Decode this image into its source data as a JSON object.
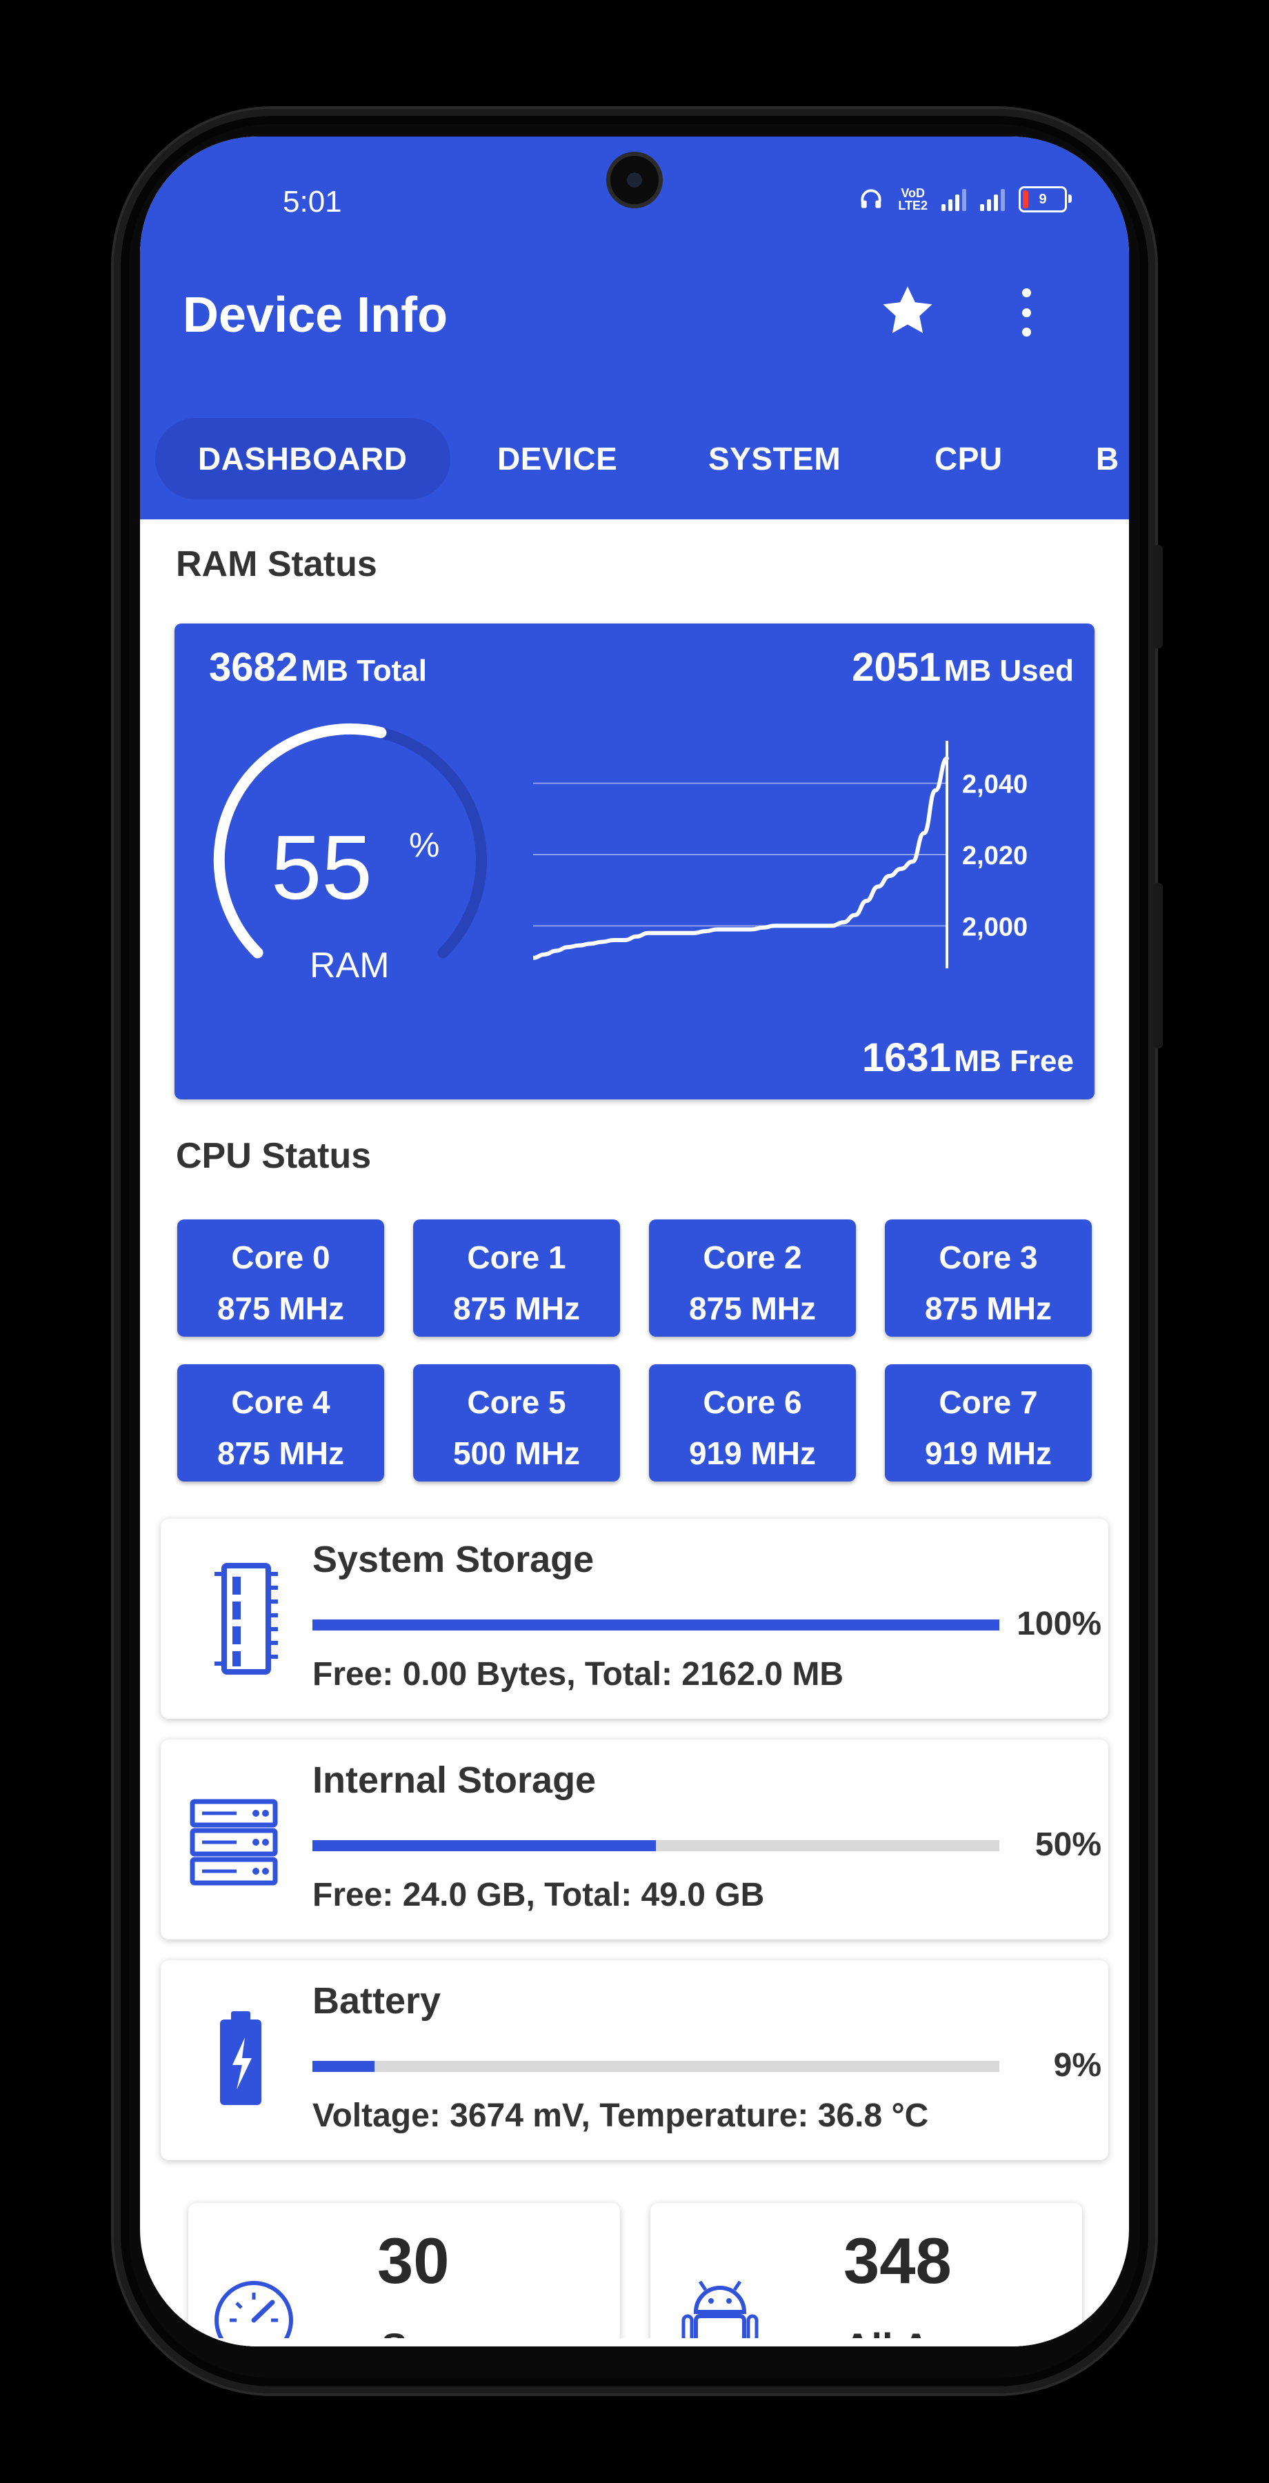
{
  "status_bar": {
    "time": "5:01",
    "volte_top": "VoD",
    "volte_bottom": "LTE2",
    "battery_level": "9",
    "battery_color": "#ff3b30"
  },
  "app_bar": {
    "title": "Device Info",
    "star_icon": "star-icon",
    "more_icon": "more-vert-icon"
  },
  "tabs": [
    "DASHBOARD",
    "DEVICE",
    "SYSTEM",
    "CPU",
    "B"
  ],
  "ram": {
    "section_title": "RAM Status",
    "total_value": "3682",
    "total_unit": "MB Total",
    "used_value": "2051",
    "used_unit": "MB Used",
    "free_value": "1631",
    "free_unit": "MB Free",
    "percent": "55",
    "percent_sign": "%",
    "gauge_label": "RAM",
    "gauge_fraction": 0.55
  },
  "chart_data": {
    "type": "line",
    "title": "",
    "xlabel": "",
    "ylabel": "",
    "yticks": [
      "2,040",
      "2,020",
      "2,000"
    ],
    "ytick_values": [
      2040,
      2020,
      2000
    ],
    "ylim": [
      1990,
      2050
    ],
    "grid": true,
    "series": [
      {
        "values": [
          1991,
          1992,
          1993,
          1994,
          1994.5,
          1995,
          1995.5,
          1996,
          1996,
          1997,
          1998,
          1998,
          1998,
          1998,
          1998,
          1998.5,
          1999,
          1999,
          1999,
          1999,
          1999.5,
          2000,
          2000,
          2000,
          2000,
          2000,
          2000,
          2001,
          2003,
          2007,
          2011,
          2014,
          2016,
          2018,
          2026,
          2038,
          2047
        ]
      }
    ]
  },
  "cpu": {
    "section_title": "CPU Status",
    "cores": [
      {
        "name": "Core 0",
        "freq": "875 MHz"
      },
      {
        "name": "Core 1",
        "freq": "875 MHz"
      },
      {
        "name": "Core 2",
        "freq": "875 MHz"
      },
      {
        "name": "Core 3",
        "freq": "875 MHz"
      },
      {
        "name": "Core 4",
        "freq": "875 MHz"
      },
      {
        "name": "Core 5",
        "freq": "500 MHz"
      },
      {
        "name": "Core 6",
        "freq": "919 MHz"
      },
      {
        "name": "Core 7",
        "freq": "919 MHz"
      }
    ]
  },
  "storage": [
    {
      "title": "System Storage",
      "percent": "100%",
      "fraction": 1.0,
      "detail": "Free: 0.00 Bytes, Total: 2162.0 MB",
      "icon": "memory-icon"
    },
    {
      "title": "Internal Storage",
      "percent": "50%",
      "fraction": 0.5,
      "detail": "Free: 24.0 GB, Total: 49.0 GB",
      "icon": "server-storage-icon"
    },
    {
      "title": "Battery",
      "percent": "9%",
      "fraction": 0.09,
      "detail": "Voltage: 3674 mV, Temperature: 36.8 °C",
      "icon": "battery-charging-icon"
    }
  ],
  "stats": [
    {
      "value": "30",
      "label": "Sensors",
      "icon": "speedometer-icon"
    },
    {
      "value": "348",
      "label": "All Apps",
      "icon": "android-icon"
    }
  ],
  "colors": {
    "primary": "#3152db",
    "tab_active": "#2a48c8",
    "progress_track": "#d9d9d9",
    "text_dark": "#333333"
  }
}
